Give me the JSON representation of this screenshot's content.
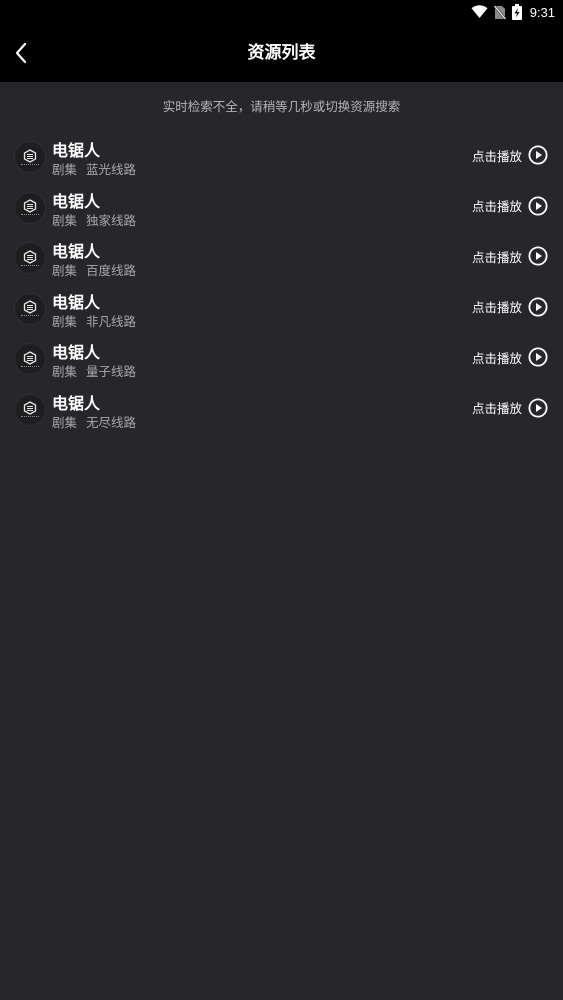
{
  "status_bar": {
    "time": "9:31",
    "icons": [
      "wifi-icon",
      "no-sim-icon",
      "battery-charging-icon"
    ]
  },
  "header": {
    "title": "资源列表",
    "back_icon": "chevron-left-icon"
  },
  "notice": "实时检索不全，请稍等几秒或切换资源搜索",
  "items": [
    {
      "title": "电锯人",
      "category": "剧集",
      "source": "蓝光线路",
      "action": "点击播放"
    },
    {
      "title": "电锯人",
      "category": "剧集",
      "source": "独家线路",
      "action": "点击播放"
    },
    {
      "title": "电锯人",
      "category": "剧集",
      "source": "百度线路",
      "action": "点击播放"
    },
    {
      "title": "电锯人",
      "category": "剧集",
      "source": "非凡线路",
      "action": "点击播放"
    },
    {
      "title": "电锯人",
      "category": "剧集",
      "source": "量子线路",
      "action": "点击播放"
    },
    {
      "title": "电锯人",
      "category": "剧集",
      "source": "无尽线路",
      "action": "点击播放"
    }
  ],
  "colors": {
    "background": "#27272b",
    "header": "#000000",
    "text": "#ffffff",
    "muted": "#a8a8ac"
  }
}
